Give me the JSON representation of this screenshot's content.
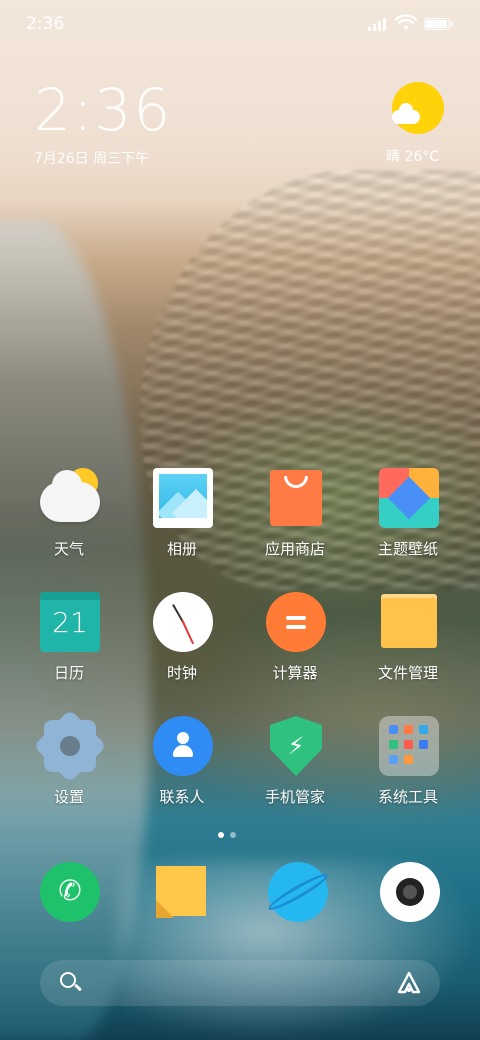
{
  "status_bar": {
    "time": "2:36",
    "signal_icon": "signal-icon",
    "wifi_icon": "wifi-icon",
    "battery_icon": "battery-icon",
    "battery_level": 1.0
  },
  "clock_widget": {
    "time": "2:36",
    "date": "7月26日 周三下午"
  },
  "weather_widget": {
    "icon": "partly-sunny-icon",
    "text": "晴 26°C"
  },
  "apps": [
    {
      "label": "天气",
      "icon": "weather-icon"
    },
    {
      "label": "相册",
      "icon": "gallery-icon"
    },
    {
      "label": "应用商店",
      "icon": "app-store-icon"
    },
    {
      "label": "主题壁纸",
      "icon": "themes-icon"
    },
    {
      "label": "日历",
      "icon": "calendar-icon",
      "icon_text": "21"
    },
    {
      "label": "时钟",
      "icon": "clock-icon"
    },
    {
      "label": "计算器",
      "icon": "calculator-icon"
    },
    {
      "label": "文件管理",
      "icon": "file-manager-icon"
    },
    {
      "label": "设置",
      "icon": "settings-icon"
    },
    {
      "label": "联系人",
      "icon": "contacts-icon"
    },
    {
      "label": "手机管家",
      "icon": "security-icon"
    },
    {
      "label": "系统工具",
      "icon": "system-tools-folder-icon"
    }
  ],
  "page_indicator": {
    "pages": 2,
    "current": 1
  },
  "dock": [
    {
      "icon": "phone-icon"
    },
    {
      "icon": "notes-icon"
    },
    {
      "icon": "browser-icon"
    },
    {
      "icon": "camera-icon"
    }
  ],
  "search_bar": {
    "search_icon": "search-icon",
    "assistant_icon": "assistant-icon"
  },
  "colors": {
    "weather_sun": "#ffd20a",
    "calendar": "#1fb5a8",
    "calculator": "#ff7b36",
    "phone": "#1ec26b",
    "contacts": "#2f8cf5",
    "security": "#2ec27e"
  }
}
